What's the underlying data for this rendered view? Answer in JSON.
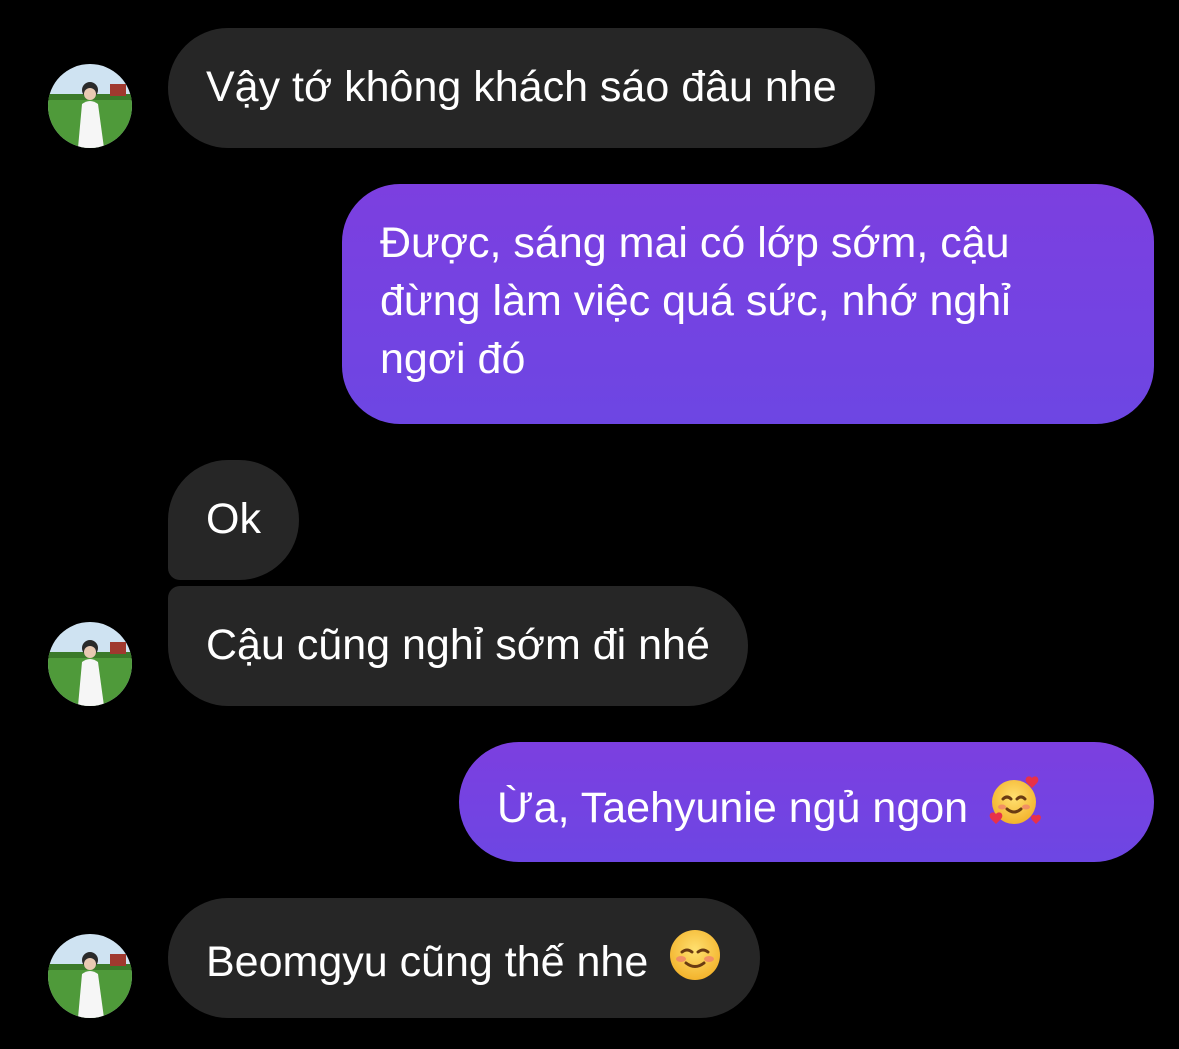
{
  "contact": {
    "avatar_icon": "profile-photo-avatar"
  },
  "colors": {
    "background": "#000000",
    "incoming_bubble": "#262626",
    "outgoing_bubble_top": "#7c3fe0",
    "outgoing_bubble_bottom": "#6d46e3",
    "text": "#ffffff"
  },
  "messages": [
    {
      "direction": "incoming",
      "text": "Vậy tớ không khách sáo đâu nhe"
    },
    {
      "direction": "outgoing",
      "lines": [
        "Được, sáng mai có lớp sớm, cậu",
        "đừng làm việc quá sức, nhớ nghỉ",
        "ngơi đó"
      ]
    },
    {
      "direction": "incoming",
      "text": "Ok"
    },
    {
      "direction": "incoming",
      "text": "Cậu cũng nghỉ sớm đi nhé"
    },
    {
      "direction": "outgoing",
      "text": "Ừa, Taehyunie ngủ ngon",
      "emoji": "smiling-face-with-hearts-emoji"
    },
    {
      "direction": "incoming",
      "text": "Beomgyu cũng thế nhe",
      "emoji": "smiling-face-emoji"
    }
  ]
}
